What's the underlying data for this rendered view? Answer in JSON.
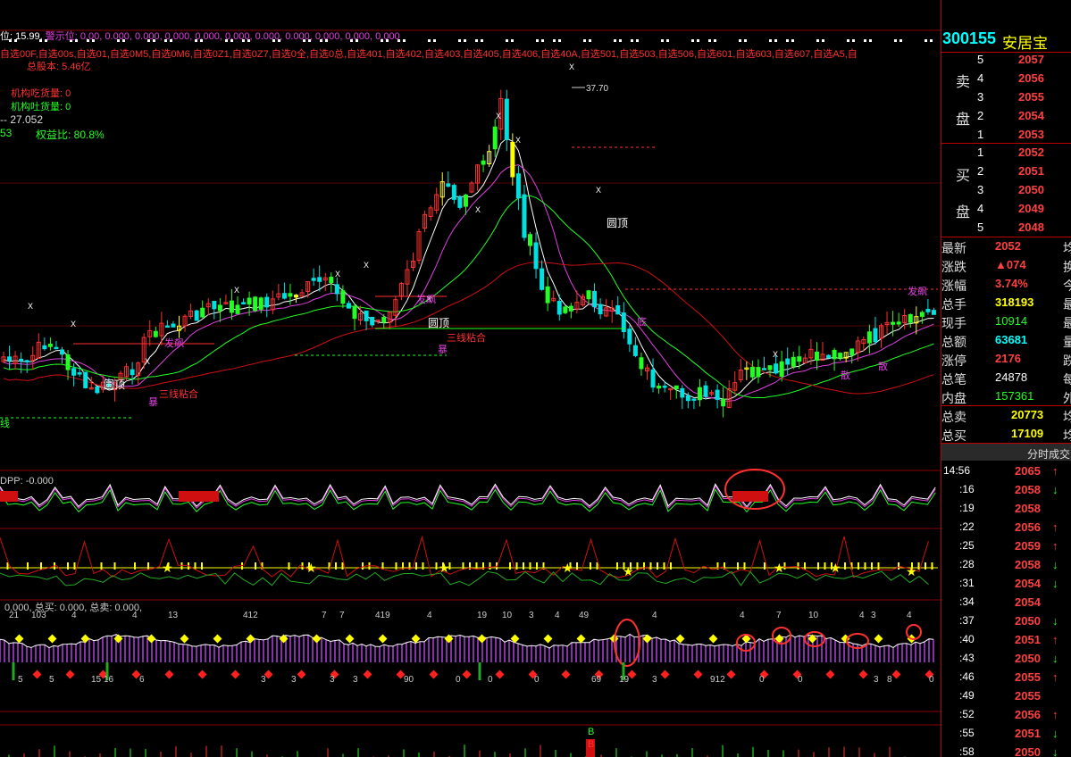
{
  "header": {
    "line1": [
      {
        "text": "位: 15.99,",
        "color": "#ffffff"
      },
      {
        "text": "警示位: 0.00, 0.000, 0.000, 0.000, 0.000, 0.000, 0.000, 0.000, 0.000, 0.000, 0.000",
        "color": "#e040e0"
      }
    ],
    "line2": "自选00F,自选00s,自选01,自选0M5,自选0M6,自选0Z1,自选0Z7,自选0全,自选0总,自选401,自选402,自选403,自选405,自选406,自选40A,自选501,自选503,自选506,自选601,自选603,自选607,自选A5,自",
    "total_shares": "总股本: 5.46亿",
    "inst_buy": "机构吃货量: 0",
    "inst_sell": "机构吐货量: 0",
    "dash_val": "-- 27.052",
    "equity_left": "53",
    "equity": "权益比: 80.8%"
  },
  "annotations": {
    "peak": "37.70",
    "top_label_1": "圆顶",
    "top_label_2": "圆顶",
    "top_label_3": "圆顶",
    "three_line_1": "三线粘合",
    "three_line_2": "三线粘合",
    "take_off_1": "发飙",
    "take_off_2": "发飙",
    "take_off_3": "发飙",
    "bottom": "底",
    "left_line": "线",
    "sell_mark": "卖",
    "violent": "暴",
    "scatter": "散",
    "buy_mark": "B"
  },
  "dpp_label": "DPP: -0.000",
  "panel3_label": "0.000, 总买: 0.000, 总卖: 0.000,",
  "panel3_numbers": [
    "21",
    "103",
    "4",
    "4",
    "13",
    "412",
    "7",
    "7",
    "419",
    "4",
    "19",
    "10",
    "3",
    "4",
    "49",
    "4",
    "4",
    "7",
    "10",
    "4",
    "3",
    "4"
  ],
  "panel3_bottom_numbers": [
    "5",
    "5",
    "15",
    "16",
    "6",
    "3",
    "3",
    "3",
    "3",
    "90",
    "0",
    "0",
    "0",
    "69",
    "19",
    "3",
    "912",
    "0",
    "0",
    "3",
    "8",
    "0"
  ],
  "stock": {
    "code": "300155",
    "name": "安居宝"
  },
  "sell_orders": [
    {
      "level": "5",
      "price": "2057"
    },
    {
      "level": "4",
      "price": "2056"
    },
    {
      "level": "3",
      "price": "2055"
    },
    {
      "level": "2",
      "price": "2054"
    },
    {
      "level": "1",
      "price": "2053"
    }
  ],
  "buy_orders": [
    {
      "level": "1",
      "price": "2052"
    },
    {
      "level": "2",
      "price": "2051"
    },
    {
      "level": "3",
      "price": "2050"
    },
    {
      "level": "4",
      "price": "2049"
    },
    {
      "level": "5",
      "price": "2048"
    }
  ],
  "sell_label_1": "卖",
  "sell_label_2": "盘",
  "buy_label_1": "买",
  "buy_label_2": "盘",
  "quote": [
    {
      "label": "最新",
      "value": "2052",
      "cls": "r",
      "extra": "均"
    },
    {
      "label": "涨跌",
      "value": "▲074",
      "cls": "r",
      "extra": "换"
    },
    {
      "label": "涨幅",
      "value": "3.74%",
      "cls": "r",
      "extra": "今"
    },
    {
      "label": "总手",
      "value": "318193",
      "cls": "y",
      "extra": "最"
    },
    {
      "label": "现手",
      "value": "10914",
      "cls": "g",
      "extra": "最"
    },
    {
      "label": "总额",
      "value": "63681",
      "cls": "c",
      "extra": "量"
    },
    {
      "label": "涨停",
      "value": "2176",
      "cls": "r",
      "extra": "跌"
    },
    {
      "label": "总笔",
      "value": "24878",
      "cls": "w",
      "extra": "每"
    },
    {
      "label": "内盘",
      "value": "157361",
      "cls": "g",
      "extra": "外"
    }
  ],
  "totals": [
    {
      "label": "总卖",
      "value": "20773",
      "cls": "y",
      "extra": "均"
    },
    {
      "label": "总买",
      "value": "17109",
      "cls": "y",
      "extra": "均"
    }
  ],
  "ticks_header": "分时成交",
  "ticks": [
    {
      "time": "14:56",
      "price": "2065",
      "dir": "up"
    },
    {
      "time": ":16",
      "price": "2058",
      "dir": "down"
    },
    {
      "time": ":19",
      "price": "2058",
      "dir": ""
    },
    {
      "time": ":22",
      "price": "2056",
      "dir": "up"
    },
    {
      "time": ":25",
      "price": "2059",
      "dir": "up"
    },
    {
      "time": ":28",
      "price": "2058",
      "dir": "down"
    },
    {
      "time": ":31",
      "price": "2054",
      "dir": "down"
    },
    {
      "time": ":34",
      "price": "2054",
      "dir": ""
    },
    {
      "time": ":37",
      "price": "2050",
      "dir": "down"
    },
    {
      "time": ":40",
      "price": "2051",
      "dir": "up"
    },
    {
      "time": ":43",
      "price": "2050",
      "dir": "down"
    },
    {
      "time": ":46",
      "price": "2055",
      "dir": "up"
    },
    {
      "time": ":49",
      "price": "2055",
      "dir": ""
    },
    {
      "time": ":52",
      "price": "2056",
      "dir": "up"
    },
    {
      "time": ":55",
      "price": "2051",
      "dir": "down"
    },
    {
      "time": ":58",
      "price": "2050",
      "dir": "down"
    }
  ]
}
